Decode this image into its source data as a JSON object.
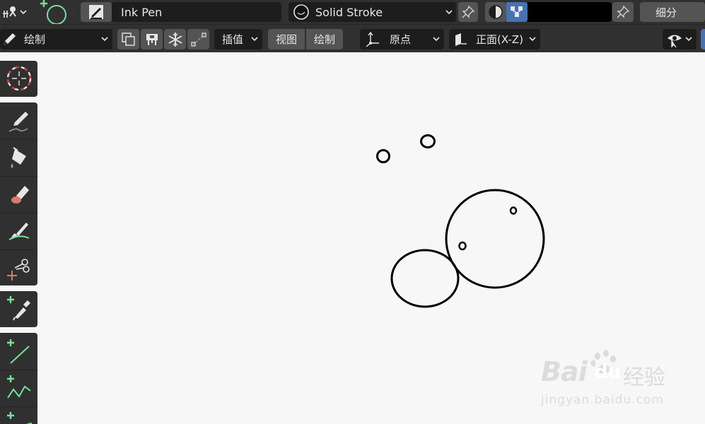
{
  "header": {
    "brush_name": "Ink Pen",
    "material_name": "Solid Stroke",
    "subdivide_label": "细分"
  },
  "toolbar": {
    "mode_label": "绘制",
    "interpolate_label": "插值",
    "view_label": "视图",
    "draw_label": "绘制",
    "origin_label": "原点",
    "plane_label": "正面(X-Z)"
  },
  "tools": [
    {
      "name": "cursor-icon"
    },
    {
      "name": "draw-icon"
    },
    {
      "name": "fill-icon"
    },
    {
      "name": "erase-icon"
    },
    {
      "name": "tint-icon"
    },
    {
      "name": "cutter-icon"
    },
    {
      "name": "eyedropper-icon"
    },
    {
      "name": "line-icon"
    },
    {
      "name": "polyline-icon"
    },
    {
      "name": "arc-icon"
    }
  ],
  "watermark": {
    "brand": "Bai",
    "brand2": "du",
    "suffix": "经验",
    "url": "jingyan.baidu.com"
  },
  "colors": {
    "ui_dark": "#1d1d1d",
    "ui_mid": "#545454",
    "ui_panel": "#303030",
    "accent_green": "#7be09a",
    "accent_blue": "#4772b3",
    "canvas_bg": "#f7f7f7",
    "stroke": "#000000"
  }
}
